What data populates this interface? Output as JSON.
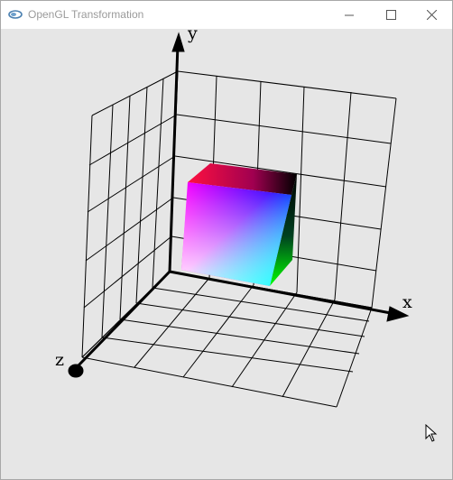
{
  "window": {
    "title": "OpenGL Transformation",
    "icon": "opengl-app-icon",
    "buttons": [
      "minimize-icon",
      "maximize-icon",
      "close-icon"
    ]
  },
  "scene": {
    "background": "#e6e6e6",
    "axis_labels": {
      "x": "x",
      "y": "y",
      "z": "z"
    },
    "grid_color": "#000000",
    "cube_corner_colors": {
      "top_back_left": "#ff0000",
      "top_back_right": "#000000",
      "top_front_left": "#ff00ff",
      "top_front_right": "#0000ff",
      "bottom_front_left": "#ffffff",
      "bottom_front_right": "#00ffff",
      "bottom_back_right": "#00ff00"
    }
  },
  "cursor": "arrow-cursor-icon"
}
